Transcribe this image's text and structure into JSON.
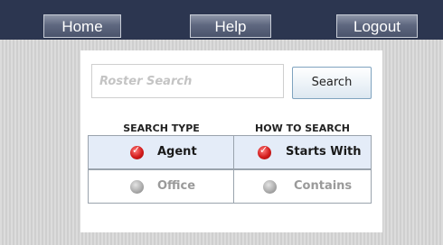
{
  "nav": {
    "home_label": "Home",
    "help_label": "Help",
    "logout_label": "Logout"
  },
  "search": {
    "placeholder": "Roster Search",
    "button_label": "Search"
  },
  "search_type": {
    "heading": "SEARCH TYPE",
    "options": [
      {
        "label": "Agent",
        "selected": true
      },
      {
        "label": "Office",
        "selected": false
      }
    ]
  },
  "how_to_search": {
    "heading": "HOW TO SEARCH",
    "options": [
      {
        "label": "Starts With",
        "selected": true
      },
      {
        "label": "Contains",
        "selected": false
      }
    ]
  },
  "colors": {
    "topbar": "#2c3650",
    "selected_bg": "#e4ecf8",
    "radio_on": "#d21b1b",
    "radio_off": "#a8a8a8"
  }
}
